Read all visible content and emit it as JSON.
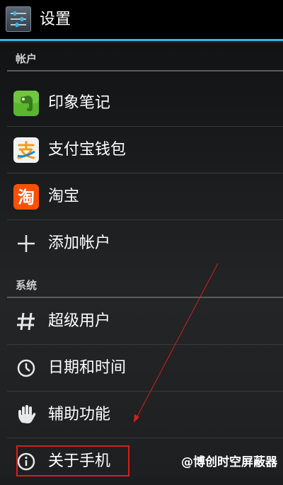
{
  "header": {
    "title": "设置",
    "icon": "settings-sliders-icon",
    "accent_color": "#33b5e5"
  },
  "sections": {
    "accounts": {
      "title": "帐户",
      "items": [
        {
          "label": "印象笔记",
          "icon": "evernote-icon"
        },
        {
          "label": "支付宝钱包",
          "icon": "alipay-icon"
        },
        {
          "label": "淘宝",
          "icon": "taobao-icon"
        },
        {
          "label": "添加帐户",
          "icon": "plus-icon"
        }
      ]
    },
    "system": {
      "title": "系统",
      "items": [
        {
          "label": "超级用户",
          "icon": "hash-icon"
        },
        {
          "label": "日期和时间",
          "icon": "clock-icon"
        },
        {
          "label": "辅助功能",
          "icon": "hand-icon"
        },
        {
          "label": "关于手机",
          "icon": "info-icon"
        }
      ]
    }
  },
  "annotation": {
    "highlight_color": "#d41f1f"
  },
  "watermark": {
    "text": "@博创时空屏蔽器"
  }
}
